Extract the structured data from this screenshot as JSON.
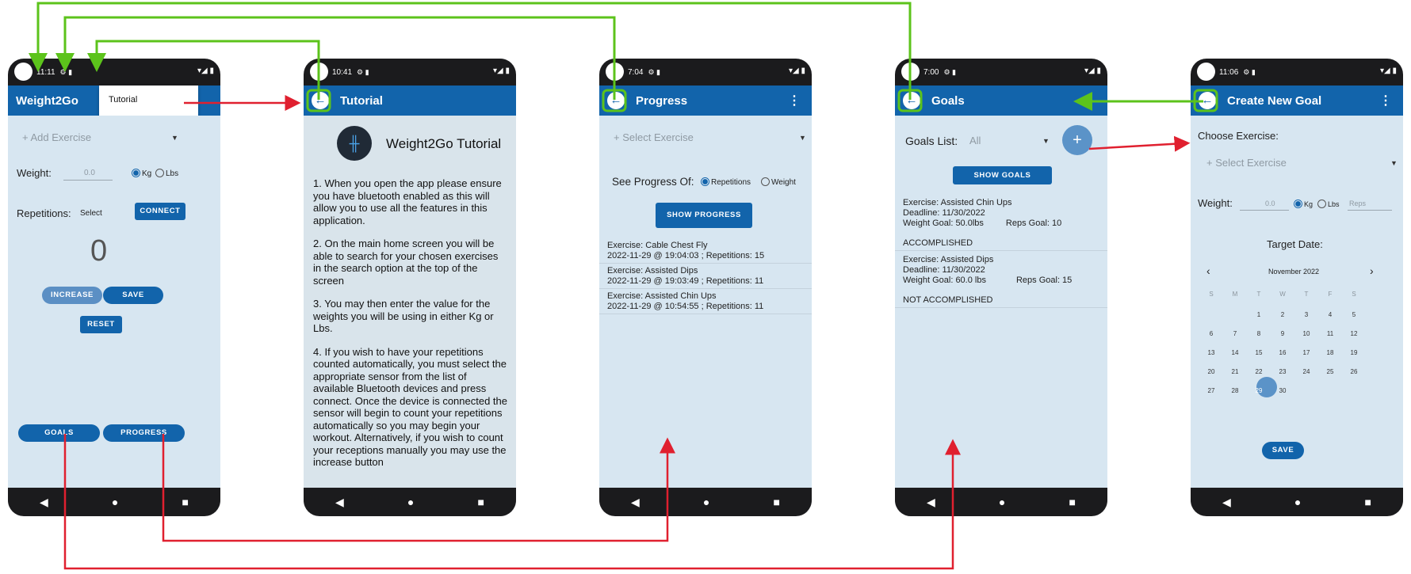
{
  "colors": {
    "app_bar": "#1264ab",
    "screen_bg": "#d7e6f1",
    "phone_frame": "#1b1b1d",
    "back_flow": "#5cc31b",
    "forward_flow": "#e0202f"
  },
  "home": {
    "status_time": "11:11",
    "title": "Weight2Go",
    "menu_item": "Tutorial",
    "add_exercise_placeholder": "+ Add Exercise",
    "weight_label": "Weight:",
    "weight_value": "0.0",
    "unit_kg": "Kg",
    "unit_lbs": "Lbs",
    "reps_label": "Repetitions:",
    "select_label": "Select",
    "connect_button": "CONNECT",
    "counter": "0",
    "increase_button": "INCREASE",
    "save_button": "SAVE",
    "reset_button": "RESET",
    "goals_button": "GOALS",
    "progress_button": "PROGRESS"
  },
  "tutorial": {
    "status_time": "10:41",
    "title": "Tutorial",
    "heading": "Weight2Go Tutorial",
    "paragraphs": [
      "1. When you open the app please ensure you have bluetooth enabled as this will allow you to use all the features in this application.",
      "2. On the main home screen you will be able to search for your chosen exercises in the search option at the top of the screen",
      "3. You may then enter the value for the weights you will be using in either Kg or Lbs.",
      "4. If you wish to have your repetitions counted automatically, you must select the appropriate sensor from the list of available Bluetooth devices and press connect. Once the device is connected the sensor will begin to count your repetitions automatically so you may begin your workout. Alternatively, if you wish to count your receptions manually you may use the increase button"
    ]
  },
  "progress": {
    "status_time": "7:04",
    "title": "Progress",
    "select_placeholder": "+ Select Exercise",
    "see_progress_label": "See Progress Of:",
    "option_reps": "Repetitions",
    "option_weight": "Weight",
    "show_button": "SHOW PROGRESS",
    "entries": [
      {
        "exercise": "Exercise: Cable Chest Fly",
        "detail": "2022-11-29 @ 19:04:03   ;   Repetitions: 15"
      },
      {
        "exercise": "Exercise: Assisted Dips",
        "detail": "2022-11-29 @ 19:03:49   ;   Repetitions: 11"
      },
      {
        "exercise": "Exercise: Assisted Chin Ups",
        "detail": "2022-11-29 @ 10:54:55   ;   Repetitions: 11"
      }
    ]
  },
  "goals": {
    "status_time": "7:00",
    "title": "Goals",
    "list_label": "Goals List:",
    "list_value": "All",
    "add_icon": "plus",
    "show_button": "SHOW GOALS",
    "entries": [
      {
        "exercise": "Exercise: Assisted Chin Ups",
        "deadline": "Deadline: 11/30/2022",
        "weight": "Weight Goal: 50.0lbs",
        "reps": "Reps Goal: 10",
        "status": "ACCOMPLISHED"
      },
      {
        "exercise": "Exercise: Assisted Dips",
        "deadline": "Deadline: 11/30/2022",
        "weight": "Weight Goal: 60.0 lbs",
        "reps": "Reps Goal: 15",
        "status": "NOT ACCOMPLISHED"
      }
    ]
  },
  "create_goal": {
    "status_time": "11:06",
    "title": "Create New Goal",
    "choose_label": "Choose Exercise:",
    "select_placeholder": "+ Select Exercise",
    "weight_label": "Weight:",
    "weight_value": "0.0",
    "unit_kg": "Kg",
    "unit_lbs": "Lbs",
    "reps_placeholder": "Reps",
    "target_label": "Target Date:",
    "month": "November 2022",
    "weekdays": [
      "S",
      "M",
      "T",
      "W",
      "T",
      "F",
      "S"
    ],
    "weeks": [
      [
        "",
        "",
        "1",
        "2",
        "3",
        "4",
        "5"
      ],
      [
        "6",
        "7",
        "8",
        "9",
        "10",
        "11",
        "12"
      ],
      [
        "13",
        "14",
        "15",
        "16",
        "17",
        "18",
        "19"
      ],
      [
        "20",
        "21",
        "22",
        "23",
        "24",
        "25",
        "26"
      ],
      [
        "27",
        "28",
        "29",
        "30",
        "",
        "",
        ""
      ]
    ],
    "selected_day": "29",
    "save_button": "SAVE"
  }
}
